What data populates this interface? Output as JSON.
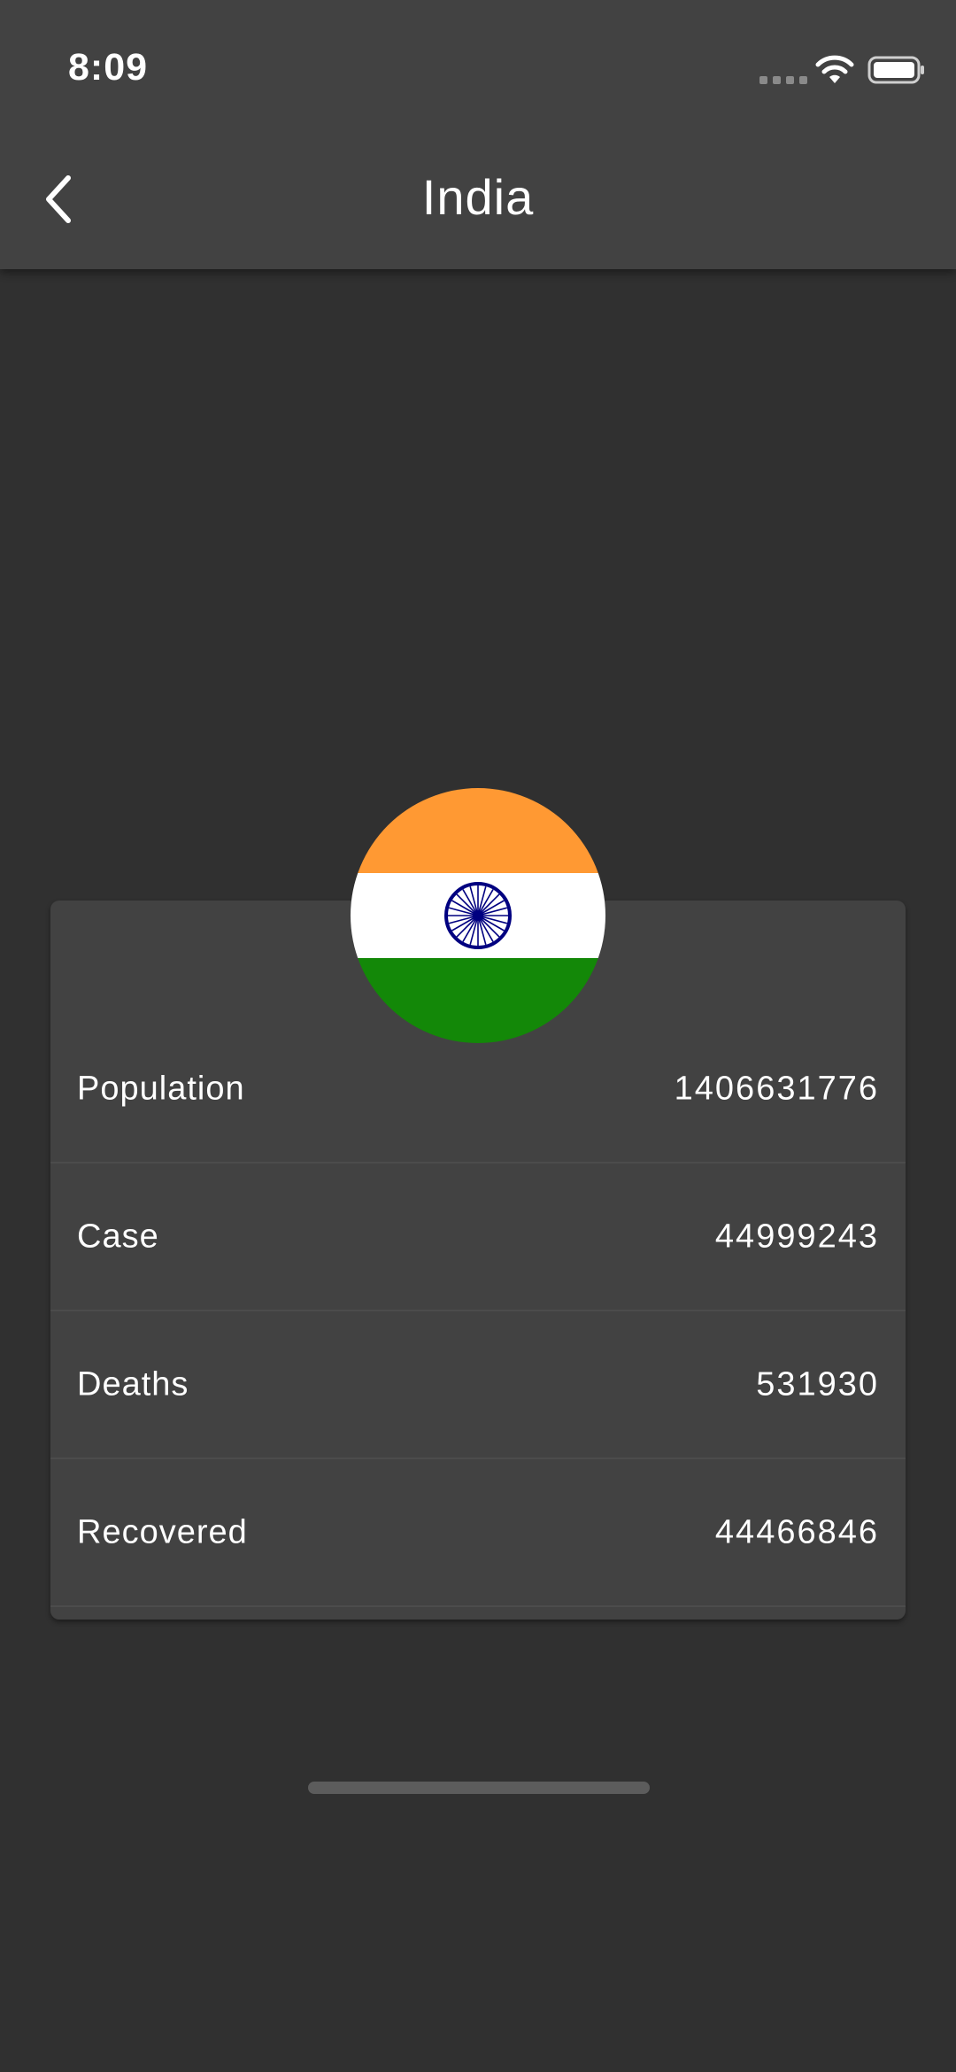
{
  "status_bar": {
    "time": "8:09"
  },
  "app_bar": {
    "title": "India",
    "back_icon": "chevron-left-icon"
  },
  "country": {
    "name": "India",
    "flag_colors": {
      "saffron": "#FF9933",
      "white": "#FFFFFF",
      "green": "#138808",
      "chakra": "#000080"
    }
  },
  "stats": [
    {
      "label": "Population",
      "value": "1406631776"
    },
    {
      "label": "Case",
      "value": "44999243"
    },
    {
      "label": "Deaths",
      "value": "531930"
    },
    {
      "label": "Recovered",
      "value": "44466846"
    }
  ],
  "theme": {
    "background": "#303030",
    "surface": "#424242",
    "text": "#FFFFFF"
  }
}
